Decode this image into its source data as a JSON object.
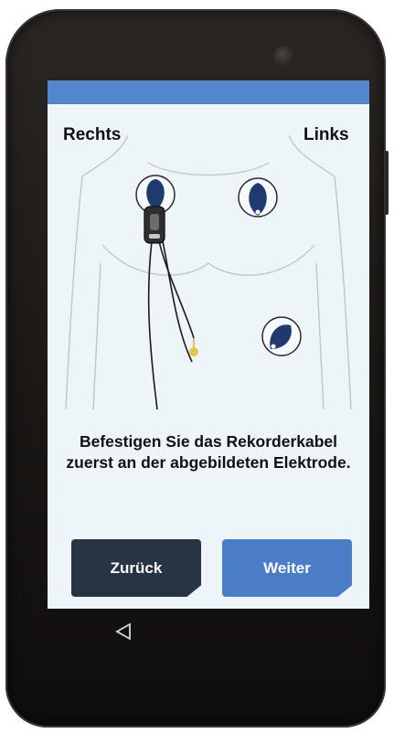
{
  "screen": {
    "labels": {
      "right": "Rechts",
      "left": "Links"
    },
    "instruction": "Befestigen Sie das Rekorderkabel zuerst an der abgebildeten Elektrode.",
    "buttons": {
      "back": "Zurück",
      "next": "Weiter"
    }
  },
  "colors": {
    "status_bar": "#5486cb",
    "screen_bg": "#eef5f8",
    "electrode_fill": "#1e3a6e",
    "snap_connector": "#e8c14a",
    "back_button": "#263443",
    "next_button": "#4a7cc8"
  },
  "nav": {
    "back_icon": "triangle-back-icon"
  }
}
